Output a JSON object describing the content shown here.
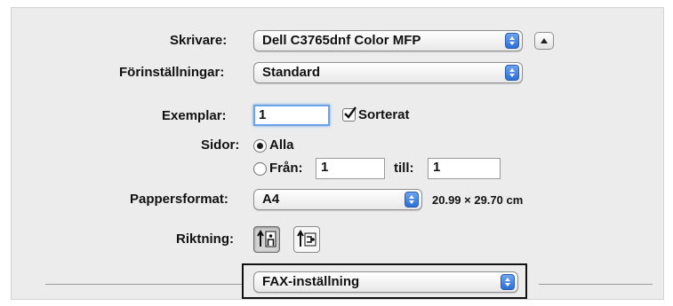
{
  "printer": {
    "label": "Skrivare:",
    "value": "Dell C3765dnf Color MFP",
    "toggle_icon": "disclosure-triangle-up-icon"
  },
  "presets": {
    "label": "Förinställningar:",
    "value": "Standard"
  },
  "copies": {
    "label": "Exemplar:",
    "value": "1",
    "collate_label": "Sorterat",
    "collate_checked": true
  },
  "pages": {
    "label": "Sidor:",
    "all_label": "Alla",
    "range_label": "Från:",
    "from_value": "1",
    "to_label": "till:",
    "to_value": "1",
    "selected": "all"
  },
  "paper": {
    "label": "Pappersformat:",
    "value": "A4",
    "dimensions": "20.99  ×  29.70 cm"
  },
  "orientation": {
    "label": "Riktning:",
    "options": [
      "portrait",
      "landscape"
    ],
    "selected": "portrait"
  },
  "section_menu": {
    "value": "FAX-inställning"
  },
  "colors": {
    "accent": "#2b6fd6",
    "panel": "#ececec",
    "focus": "#6aa2e8"
  }
}
